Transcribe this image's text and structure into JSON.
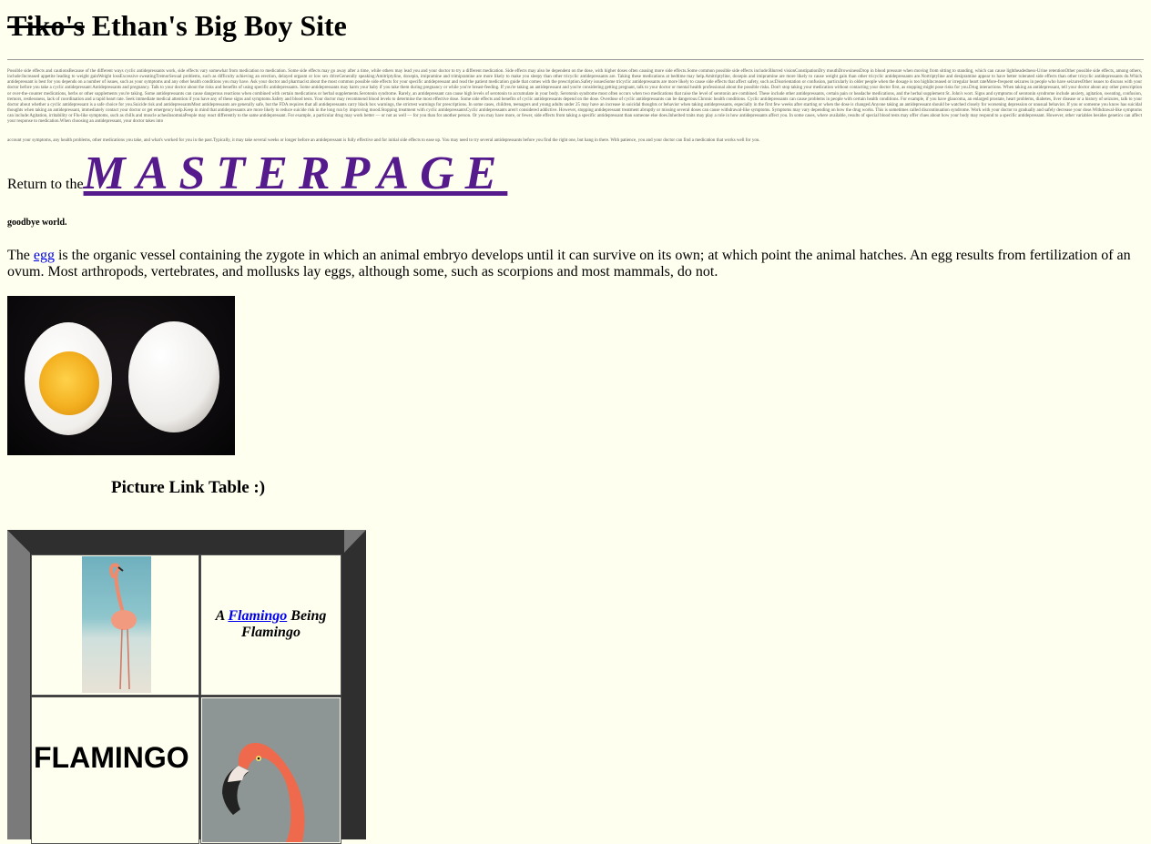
{
  "header": {
    "struck_name": "Tiko's",
    "title_rest": "Ethan's Big Boy Site"
  },
  "fine_print": {
    "block1": "Possible side effects and cautionsBecause of the different ways cyclic antidepressants work, side effects vary somewhat from medication to medication. Some side effects may go away after a time, while others may lead you and your doctor to try a different medication. Side effects may also be dependent on the dose, with higher doses often causing more side effects.Some common possible side effects include:Blurred visionConstipationDry mouthDrowsinessDrop in blood pressure when moving from sitting to standing, which can cause lightheadedness-Urine retentionOther possible side effects, among others, include:Increased appetite leading to weight gainWeight lossExcessive sweatingTremorSexual problems, such as difficulty achieving an erection, delayed orgasm or low sex driveGenerally speaking:Amitriptyline, doxepin, imipramine and trimipramine are more likely to make you sleepy than other tricyclic antidepressants are. Taking these medications at bedtime may help.Amitriptyline, doxepin and imipramine are more likely to cause weight gain than other tricyclic antidepressants are.Nortriptyline and desipramine appear to have better tolerated side effects than other tricyclic antidepressants do.Which antidepressant is best for you depends on a number of issues, such as your symptoms and any other health conditions you may have. Ask your doctor and pharmacist about the most common possible side effects for your specific antidepressant and read the patient medication guide that comes with the prescription.Safety issuesSome tricyclic antidepressants are more likely to cause side effects that affect safety, such as:Disorientation or confusion, particularly in older people when the dosage is too highIncreased or irregular heart rateMore-frequent seizures in people who have seizuresOther issues to discuss with your doctor before you take a cyclic antidepressant:Antidepressants and pregnancy. Talk to your doctor about the risks and benefits of using specific antidepressants. Some antidepressants may harm your baby if you take them during pregnancy or while you're breast-feeding. If you're taking an antidepressant and you're considering getting pregnant, talk to your doctor or mental health professional about the possible risks. Don't stop taking your medication without contacting your doctor first, as stopping might pose risks for you.Drug interactions. When taking an antidepressant, tell your doctor about any other prescription or over-the-counter medications, herbs or other supplements you're taking. Some antidepressants can cause dangerous reactions when combined with certain medications or herbal supplements.Serotonin syndrome. Rarely, an antidepressant can cause high levels of serotonin to accumulate in your body. Serotonin syndrome most often occurs when two medications that raise the level of serotonin are combined. These include other antidepressants, certain pain or headache medications, and the herbal supplement St. John's wort. Signs and symptoms of serotonin syndrome include anxiety, agitation, sweating, confusion, tremors, restlessness, lack of coordination and a rapid heart rate. Seek immediate medical attention if you have any of these signs and symptoms.Safety and blood tests. Your doctor may recommend blood levels to determine the most effective dose. Some side effects and benefits of cyclic antidepressants depend on the dose. Overdose of cyclic antidepressants can be dangerous.Chronic health conditions. Cyclic antidepressants can cause problems in people with certain health conditions. For example, if you have glaucoma, an enlarged prostate, heart problems, diabetes, liver disease or a history of seizures, talk to your doctor about whether a cyclic antidepressant is a safe choice for you.Suicide risk and antidepressantsMost antidepressants are generally safe, but the FDA requires that all antidepressants carry black box warnings, the strictest warnings for prescriptions. In some cases, children, teenagers and young adults under 25 may have an increase in suicidal thoughts or behavior when taking antidepressants, especially in the first few weeks after starting or when the dose is changed.Anyone taking an antidepressant should be watched closely for worsening depression or unusual behavior. If you or someone you know has suicidal thoughts when taking an antidepressant, immediately contact your doctor or get emergency help.Keep in mind that antidepressants are more likely to reduce suicide risk in the long run by improving mood.Stopping treatment with cyclic antidepressantsCyclic antidepressants aren't considered addictive. However, stopping antidepressant treatment abruptly or missing several doses can cause withdrawal-like symptoms. Symptoms may vary depending on how the drug works. This is sometimes called discontinuation syndrome. Work with your doctor to gradually and safely decrease your dose.Withdrawal-like symptoms can include:Agitation, irritability or Flu-like symptoms, such as chills and muscle achesInsomniaPeople may react differently to the same antidepressant. For example, a particular drug may work better — or not as well — for you than for another person. Or you may have more, or fewer, side effects from taking a specific antidepressant than someone else does.Inherited traits may play a role in how antidepressants affect you. In some cases, where available, results of special blood tests may offer clues about how your body may respond to a specific antidepressant. However, other variables besides genetics can affect your response to medication.When choosing an antidepressant, your doctor takes into",
    "block2": "account your symptoms, any health problems, other medications you take, and what's worked for you in the past.Typically, it may take several weeks or longer before an antidepressant is fully effective and for initial side effects to ease up. You may need to try several antidepressants before you find the right one, but hang in there. With patience, you and your doctor can find a medication that works well for you."
  },
  "return_line": {
    "prefix": "Return to the",
    "link": "MASTERPAGE"
  },
  "goodbye": "goodbye world.",
  "egg_para": {
    "before": "The ",
    "link": "egg",
    "after": " is the organic vessel containing the zygote in which an animal embryo develops until it can survive on its own; at which point the animal hatches. An egg results from fertilization of an ovum. Most arthropods, vertebrates, and mollusks lay eggs, although some, such as scorpions and most mammals, do not."
  },
  "table": {
    "caption": "Picture Link Table :)",
    "cap_before": "A ",
    "cap_link": "Flamingo",
    "cap_after": " Being Flamingo",
    "big_word": "FLAMINGO"
  }
}
